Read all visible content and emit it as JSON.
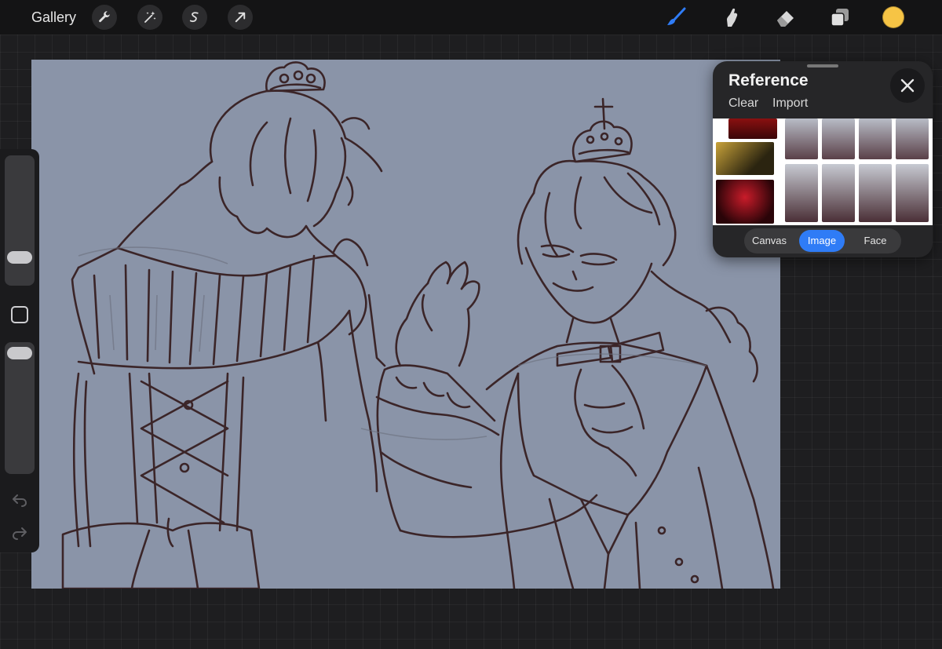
{
  "topbar": {
    "gallery_label": "Gallery",
    "left_tools": [
      "wrench-icon",
      "magic-wand-icon",
      "selection-s-icon",
      "transform-arrow-icon"
    ],
    "right_tools": [
      "brush-icon",
      "smudge-icon",
      "eraser-icon",
      "layers-icon"
    ],
    "active_color": "#f6c445",
    "active_tool_color": "#2f7cf6"
  },
  "sidebar": {
    "size_slider_level": 0.22,
    "opacity_slider_level": 0.92,
    "modify_button_icon": "square-icon",
    "undo_icon": "undo-icon",
    "redo_icon": "redo-icon"
  },
  "canvas": {
    "background_color": "#8a94a8",
    "line_color": "#3b2528"
  },
  "reference": {
    "title": "Reference",
    "clear_label": "Clear",
    "import_label": "Import",
    "close_icon": "close-icon",
    "modes": [
      {
        "label": "Canvas",
        "active": false
      },
      {
        "label": "Image",
        "active": true
      },
      {
        "label": "Face",
        "active": false
      }
    ]
  }
}
